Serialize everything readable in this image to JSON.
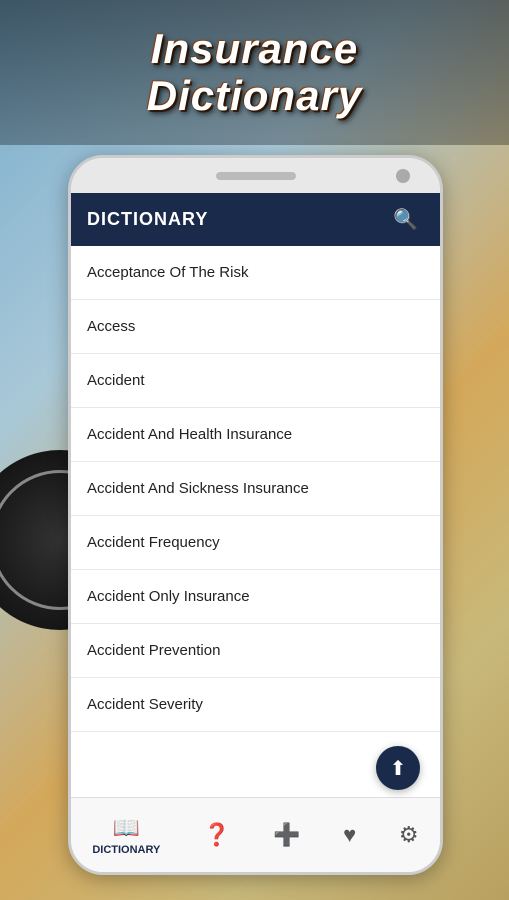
{
  "header": {
    "title_line1": "Insurance",
    "title_line2": "Dictionary"
  },
  "dictionary": {
    "header_label": "DICTIONARY",
    "search_icon": "🔍",
    "items": [
      {
        "id": 1,
        "label": "Acceptance Of The Risk"
      },
      {
        "id": 2,
        "label": "Access"
      },
      {
        "id": 3,
        "label": "Accident"
      },
      {
        "id": 4,
        "label": "Accident And Health Insurance"
      },
      {
        "id": 5,
        "label": "Accident And Sickness Insurance"
      },
      {
        "id": 6,
        "label": "Accident Frequency"
      },
      {
        "id": 7,
        "label": "Accident Only Insurance"
      },
      {
        "id": 8,
        "label": "Accident Prevention"
      },
      {
        "id": 9,
        "label": "Accident Severity"
      }
    ]
  },
  "fab": {
    "icon": "⬆",
    "label": "scroll-to-top"
  },
  "bottom_nav": {
    "items": [
      {
        "id": "dictionary",
        "icon": "📖",
        "label": "DICTIONARY",
        "active": true
      },
      {
        "id": "help",
        "icon": "❓",
        "label": "",
        "active": false
      },
      {
        "id": "add",
        "icon": "➕",
        "label": "",
        "active": false
      },
      {
        "id": "favorites",
        "icon": "♥",
        "label": "",
        "active": false
      },
      {
        "id": "settings",
        "icon": "⚙",
        "label": "",
        "active": false
      }
    ]
  }
}
